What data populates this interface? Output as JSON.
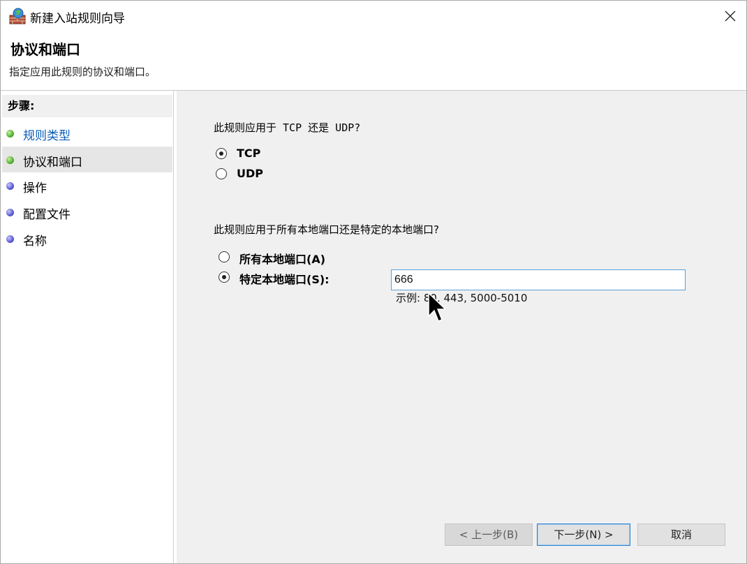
{
  "window": {
    "title": "新建入站规则向导",
    "header_title": "协议和端口",
    "header_desc": "指定应用此规则的协议和端口。"
  },
  "sidebar": {
    "steps_header": "步骤:",
    "items": [
      {
        "label": "规则类型",
        "bullet": "green",
        "state": "link"
      },
      {
        "label": "协议和端口",
        "bullet": "green",
        "state": "active"
      },
      {
        "label": "操作",
        "bullet": "blue",
        "state": "normal"
      },
      {
        "label": "配置文件",
        "bullet": "blue",
        "state": "normal"
      },
      {
        "label": "名称",
        "bullet": "blue",
        "state": "normal"
      }
    ]
  },
  "protocol": {
    "question": "此规则应用于 TCP 还是 UDP?",
    "options": [
      {
        "label": "TCP",
        "selected": true
      },
      {
        "label": "UDP",
        "selected": false
      }
    ]
  },
  "ports": {
    "question": "此规则应用于所有本地端口还是特定的本地端口?",
    "options": [
      {
        "label": "所有本地端口(A)",
        "selected": false
      },
      {
        "label": "特定本地端口(S):",
        "selected": true
      }
    ],
    "input_value": "666",
    "example": "示例: 80, 443, 5000-5010"
  },
  "buttons": {
    "back": "< 上一步(B)",
    "next": "下一步(N) >",
    "cancel": "取消"
  },
  "colors": {
    "link": "#0a5cb8",
    "content_bg": "#f0f0f0",
    "focus_border": "#5aa0d8"
  },
  "icons": {
    "app": "firewall-icon",
    "close": "close-icon",
    "cursor": "mouse-pointer-icon"
  }
}
